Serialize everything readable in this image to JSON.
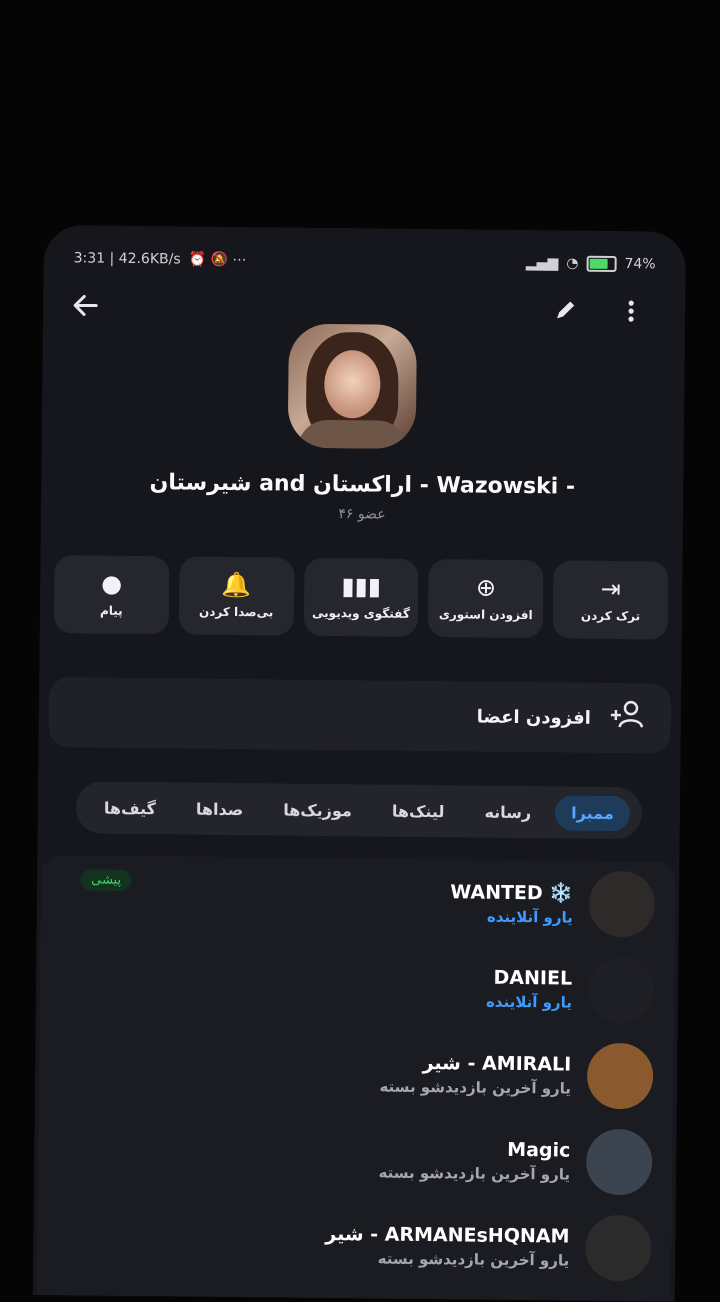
{
  "statusbar": {
    "left": "3:31 | 42.6KB/s",
    "battery": "74"
  },
  "topbar": {
    "back_icon": "back-arrow-icon",
    "edit_icon": "pencil-icon",
    "more_icon": "more-vertical-icon"
  },
  "group": {
    "title": "شیرستان and اراکستان - Wazowski -",
    "members_count": "۴۶ عضو"
  },
  "actions": [
    {
      "label": "ترک کردن",
      "icon": "leave-icon"
    },
    {
      "label": "افزودن استوری",
      "icon": "add-story-icon"
    },
    {
      "label": "گفتگوی ویدیویی",
      "icon": "video-chat-icon"
    },
    {
      "label": "بی‌صدا کردن",
      "icon": "bell-icon"
    },
    {
      "label": "پیام",
      "icon": "message-icon"
    }
  ],
  "add_members": {
    "label": "افزودن اعضا",
    "icon": "add-user-icon"
  },
  "tabs": [
    {
      "label": "ممبرا",
      "active": true
    },
    {
      "label": "رسانه",
      "active": false
    },
    {
      "label": "لینک‌ها",
      "active": false
    },
    {
      "label": "موزیک‌ها",
      "active": false
    },
    {
      "label": "صداها",
      "active": false
    },
    {
      "label": "گیف‌ها",
      "active": false
    }
  ],
  "members": [
    {
      "name": "WANTED ❄️",
      "status": "یارو آنلاینده",
      "online": true,
      "badge": "پیشی",
      "color": "#2e2a2a"
    },
    {
      "name": "DANIEL",
      "status": "یارو آنلاینده",
      "online": true,
      "color": "#1e1f24"
    },
    {
      "name": "شیر - AMIRALI",
      "status": "یارو آخرین بازدیدشو بسته",
      "online": false,
      "color": "#8a5a2e"
    },
    {
      "name": "Magic",
      "status": "یارو آخرین بازدیدشو بسته",
      "online": false,
      "color": "#3c4450"
    },
    {
      "name": "شیر - ARMANEsHQNAM",
      "status": "یارو آخرین بازدیدشو بسته",
      "online": false,
      "color": "#2b2b2b"
    }
  ]
}
